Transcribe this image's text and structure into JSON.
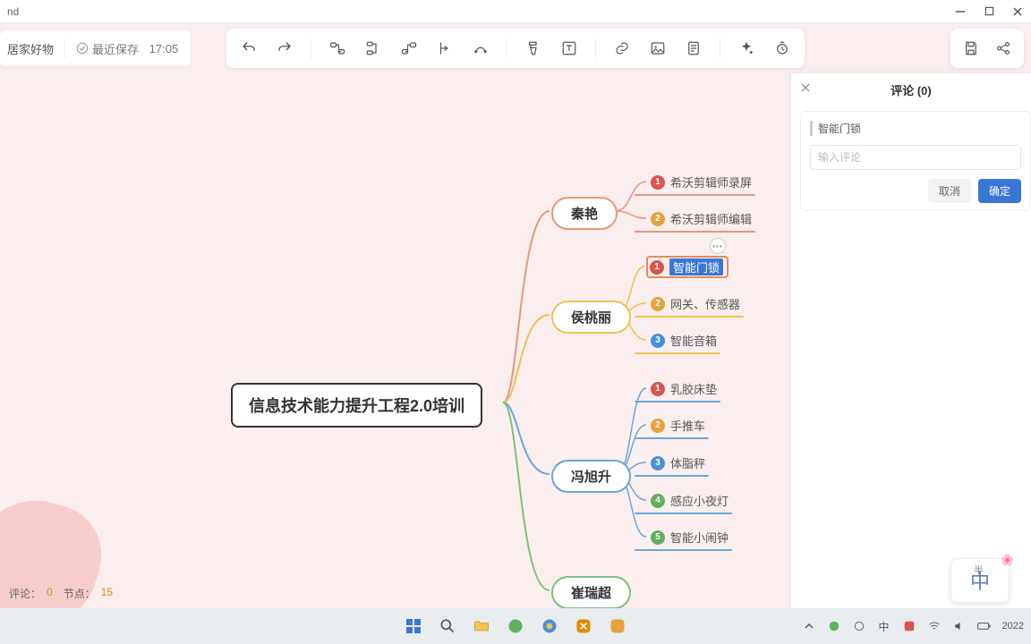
{
  "titlebar": {
    "app_name": "nd"
  },
  "doc": {
    "title": "居家好物",
    "save_prefix": "最近保存",
    "save_time": "17:05"
  },
  "comments": {
    "title": "评论 (0)",
    "subject": "智能门锁",
    "placeholder": "输入评论",
    "cancel": "取消",
    "confirm": "确定"
  },
  "status": {
    "comments_label": "评论：",
    "comments_count": "0",
    "nodes_label": "节点：",
    "nodes_count": "15"
  },
  "mindmap": {
    "root": "信息技术能力提升工程2.0培训",
    "branches": [
      {
        "name": "秦艳",
        "color": "#e9957b",
        "children": [
          {
            "num": "1",
            "label": "希沃剪辑师录屏"
          },
          {
            "num": "2",
            "label": "希沃剪辑师编辑"
          }
        ]
      },
      {
        "name": "侯桃丽",
        "color": "#efc24d",
        "children": [
          {
            "num": "1",
            "label": "智能门锁",
            "selected": true
          },
          {
            "num": "2",
            "label": "网关、传感器"
          },
          {
            "num": "3",
            "label": "智能音箱"
          }
        ]
      },
      {
        "name": "冯旭升",
        "color": "#6aa6d8",
        "children": [
          {
            "num": "1",
            "label": "乳胶床垫"
          },
          {
            "num": "2",
            "label": "手推车"
          },
          {
            "num": "3",
            "label": "体脂秤"
          },
          {
            "num": "4",
            "label": "感应小夜灯"
          },
          {
            "num": "5",
            "label": "智能小闹钟"
          }
        ]
      },
      {
        "name": "崔瑞超",
        "color": "#7fbf7f",
        "children": []
      }
    ]
  },
  "badge_colors": [
    "#d9534f",
    "#e8a13c",
    "#4a90d9",
    "#5fb05f",
    "#5fb05f"
  ],
  "taskbar": {
    "clock": "2022"
  },
  "ime": {
    "label": "中",
    "sub": "半"
  }
}
